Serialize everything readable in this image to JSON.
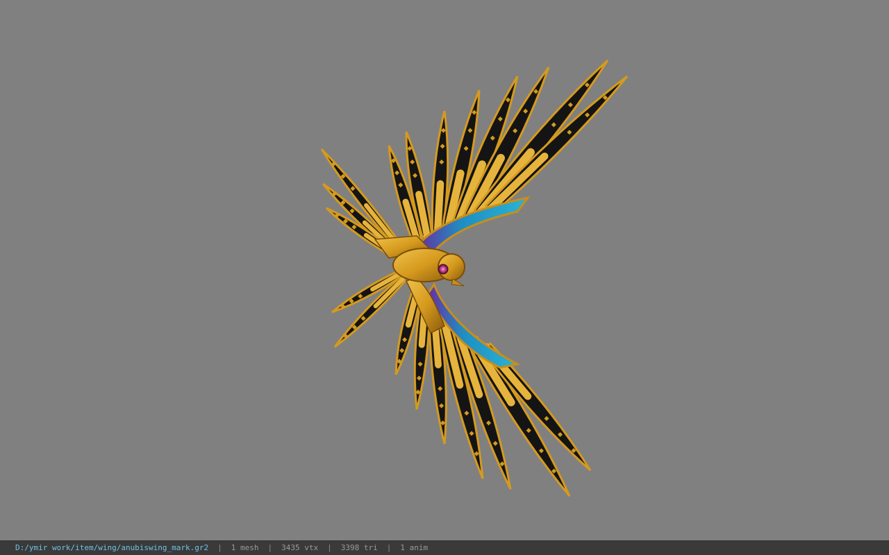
{
  "viewer": {
    "background_color": "#808080",
    "model_icon": "golden-winged-scarab-icon",
    "colors": {
      "feather_black": "#141414",
      "feather_edge_gold": "#d59a1e",
      "gold_light": "#e6b43c",
      "gold_dark": "#8a5a0c",
      "enamel_blue": "#1f8ec2",
      "enamel_cyan": "#2ab3d6",
      "enamel_purple": "#6a2ca0",
      "eye_magenta": "#b0307a"
    }
  },
  "status_bar": {
    "file_path": "D:/ymir work/item/wing/anubiswing_mark.gr2",
    "separator": "|",
    "mesh_count": "1 mesh",
    "vertex_count": "3435 vtx",
    "triangle_count": "3398 tri",
    "anim_count": "1 anim"
  }
}
